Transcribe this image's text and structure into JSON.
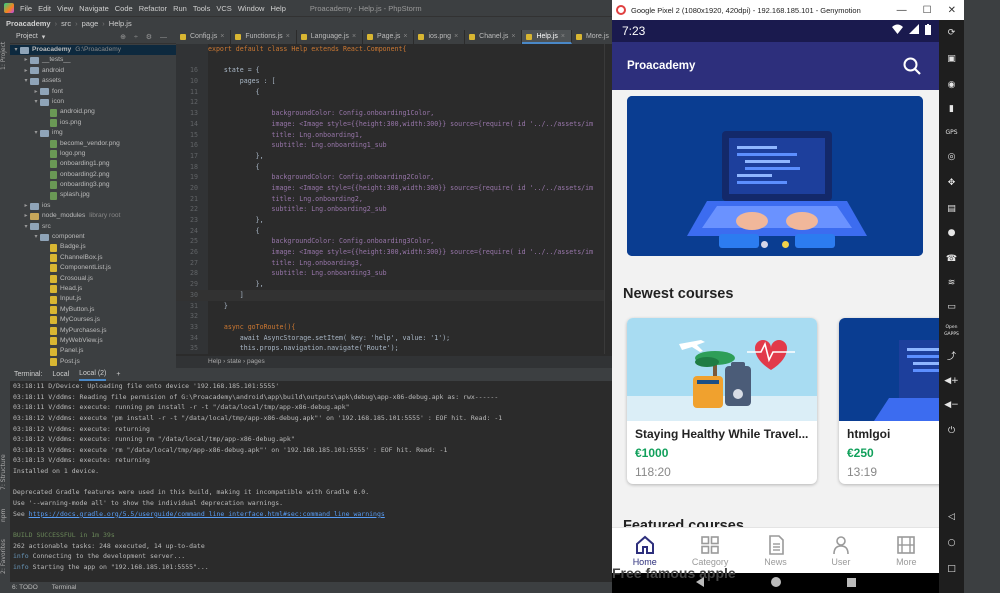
{
  "ide": {
    "menu": [
      "File",
      "Edit",
      "View",
      "Navigate",
      "Code",
      "Refactor",
      "Run",
      "Tools",
      "VCS",
      "Window",
      "Help"
    ],
    "window_title": "Proacademy - Help.js - PhpStorm",
    "breadcrumb": [
      "Proacademy",
      "src",
      "page",
      "Help.js"
    ],
    "editor_tabs": [
      {
        "label": "Config.js",
        "active": false
      },
      {
        "label": "Functions.js",
        "active": false
      },
      {
        "label": "Language.js",
        "active": false
      },
      {
        "label": "Page.js",
        "active": false
      },
      {
        "label": "ios.png",
        "active": false
      },
      {
        "label": "Chanel.js",
        "active": false
      },
      {
        "label": "Help.js",
        "active": true
      },
      {
        "label": "More.js",
        "active": false
      },
      {
        "label": "Index.",
        "active": false
      }
    ],
    "left_strip": {
      "project": "1: Project",
      "structure": "7: Structure",
      "npm": "npm",
      "favorites": "2: Favorites"
    },
    "project_panel": {
      "title": "Project",
      "icons": "⊕ ÷ ⚙ —"
    },
    "tree": [
      {
        "indent": 0,
        "arrow": "▾",
        "kind": "folder",
        "label": "Proacademy",
        "muted": "G:\\Proacademy",
        "sel": true
      },
      {
        "indent": 1,
        "arrow": "▸",
        "kind": "folder",
        "label": "__tests__"
      },
      {
        "indent": 1,
        "arrow": "▸",
        "kind": "folder",
        "label": "android"
      },
      {
        "indent": 1,
        "arrow": "▾",
        "kind": "folder",
        "label": "assets"
      },
      {
        "indent": 2,
        "arrow": "▸",
        "kind": "folder",
        "label": "font"
      },
      {
        "indent": 2,
        "arrow": "▾",
        "kind": "folder",
        "label": "icon"
      },
      {
        "indent": 3,
        "arrow": "",
        "kind": "png",
        "label": "android.png"
      },
      {
        "indent": 3,
        "arrow": "",
        "kind": "png",
        "label": "ios.png"
      },
      {
        "indent": 2,
        "arrow": "▾",
        "kind": "folder",
        "label": "img"
      },
      {
        "indent": 3,
        "arrow": "",
        "kind": "png",
        "label": "become_vendor.png"
      },
      {
        "indent": 3,
        "arrow": "",
        "kind": "png",
        "label": "logo.png"
      },
      {
        "indent": 3,
        "arrow": "",
        "kind": "png",
        "label": "onboarding1.png"
      },
      {
        "indent": 3,
        "arrow": "",
        "kind": "png",
        "label": "onboarding2.png"
      },
      {
        "indent": 3,
        "arrow": "",
        "kind": "png",
        "label": "onboarding3.png"
      },
      {
        "indent": 3,
        "arrow": "",
        "kind": "png",
        "label": "splash.jpg"
      },
      {
        "indent": 1,
        "arrow": "▸",
        "kind": "folder",
        "label": "ios"
      },
      {
        "indent": 1,
        "arrow": "▸",
        "kind": "yfolder",
        "label": "node_modules",
        "muted": "library root"
      },
      {
        "indent": 1,
        "arrow": "▾",
        "kind": "folder",
        "label": "src"
      },
      {
        "indent": 2,
        "arrow": "▾",
        "kind": "folder",
        "label": "component"
      },
      {
        "indent": 3,
        "arrow": "",
        "kind": "js",
        "label": "Badge.js"
      },
      {
        "indent": 3,
        "arrow": "",
        "kind": "js",
        "label": "ChannelBox.js"
      },
      {
        "indent": 3,
        "arrow": "",
        "kind": "js",
        "label": "ComponentList.js"
      },
      {
        "indent": 3,
        "arrow": "",
        "kind": "js",
        "label": "Crosoual.js"
      },
      {
        "indent": 3,
        "arrow": "",
        "kind": "js",
        "label": "Head.js"
      },
      {
        "indent": 3,
        "arrow": "",
        "kind": "js",
        "label": "Input.js"
      },
      {
        "indent": 3,
        "arrow": "",
        "kind": "js",
        "label": "MyButton.js"
      },
      {
        "indent": 3,
        "arrow": "",
        "kind": "js",
        "label": "MyCourses.js"
      },
      {
        "indent": 3,
        "arrow": "",
        "kind": "js",
        "label": "MyPurchases.js"
      },
      {
        "indent": 3,
        "arrow": "",
        "kind": "js",
        "label": "MyWebView.js"
      },
      {
        "indent": 3,
        "arrow": "",
        "kind": "js",
        "label": "Panel.js"
      },
      {
        "indent": 3,
        "arrow": "",
        "kind": "js",
        "label": "Post.js"
      }
    ],
    "code": [
      {
        "n": "",
        "t": "export default class Help extends React.Component{",
        "k": "class"
      },
      {
        "n": "",
        "t": "",
        "k": ""
      },
      {
        "n": "16",
        "t": "    state = {",
        "k": "plain"
      },
      {
        "n": "10",
        "t": "        pages : [",
        "k": "plain"
      },
      {
        "n": "11",
        "t": "            {",
        "k": "plain"
      },
      {
        "n": "12",
        "t": "",
        "k": ""
      },
      {
        "n": "13",
        "t": "                backgroundColor: Config.onboarding1Color,",
        "k": "prop"
      },
      {
        "n": "14",
        "t": "                image: <Image style={{height:300,width:300}} source={require( id '../../assets/im",
        "k": "img"
      },
      {
        "n": "15",
        "t": "                title: Lng.onboarding1,",
        "k": "prop"
      },
      {
        "n": "16",
        "t": "                subtitle: Lng.onboarding1_sub",
        "k": "prop"
      },
      {
        "n": "17",
        "t": "            },",
        "k": "plain"
      },
      {
        "n": "18",
        "t": "            {",
        "k": "plain"
      },
      {
        "n": "19",
        "t": "                backgroundColor: Config.onboarding2Color,",
        "k": "prop"
      },
      {
        "n": "20",
        "t": "                image: <Image style={{height:300,width:300}} source={require( id '../../assets/im",
        "k": "img"
      },
      {
        "n": "21",
        "t": "                title: Lng.onboarding2,",
        "k": "prop"
      },
      {
        "n": "22",
        "t": "                subtitle: Lng.onboarding2_sub",
        "k": "prop"
      },
      {
        "n": "23",
        "t": "            },",
        "k": "plain"
      },
      {
        "n": "24",
        "t": "            {",
        "k": "plain"
      },
      {
        "n": "25",
        "t": "                backgroundColor: Config.onboarding3Color,",
        "k": "prop"
      },
      {
        "n": "26",
        "t": "                image: <Image style={{height:300,width:300}} source={require( id '../../assets/im",
        "k": "img"
      },
      {
        "n": "27",
        "t": "                title: Lng.onboarding3,",
        "k": "prop"
      },
      {
        "n": "28",
        "t": "                subtitle: Lng.onboarding3_sub",
        "k": "prop"
      },
      {
        "n": "29",
        "t": "            },",
        "k": "plain"
      },
      {
        "n": "30",
        "t": "        ]",
        "k": "cur"
      },
      {
        "n": "31",
        "t": "    }",
        "k": "plain"
      },
      {
        "n": "32",
        "t": "",
        "k": ""
      },
      {
        "n": "33",
        "t": "    async goToRoute(){",
        "k": "async"
      },
      {
        "n": "34",
        "t": "        await AsyncStorage.setItem( key: 'help', value: '1');",
        "k": "await"
      },
      {
        "n": "35",
        "t": "        this.props.navigation.navigate('Route');",
        "k": "nav"
      }
    ],
    "code_breadcrumb": "Help   ›   state   ›   pages",
    "terminal_tabs": [
      "Terminal:",
      "Local",
      "Local (2)",
      "+"
    ],
    "terminal_lines": [
      {
        "t": "03:18:11 D/Device: Uploading file onto device '192.168.185.101:5555'",
        "k": "plain"
      },
      {
        "t": "03:18:11 V/ddms: Reading file permision of G:\\Proacademy\\android\\app\\build\\outputs\\apk\\debug\\app-x86-debug.apk as: rwx------",
        "k": "plain"
      },
      {
        "t": "03:18:11 V/ddms: execute: running pm install -r -t \"/data/local/tmp/app-x86-debug.apk\"",
        "k": "plain"
      },
      {
        "t": "03:18:12 V/ddms: execute 'pm install -r -t \"/data/local/tmp/app-x86-debug.apk\"' on '192.168.185.101:5555' : EOF hit. Read: -1",
        "k": "plain"
      },
      {
        "t": "03:18:12 V/ddms: execute: returning",
        "k": "plain"
      },
      {
        "t": "03:18:12 V/ddms: execute: running rm \"/data/local/tmp/app-x86-debug.apk\"",
        "k": "plain"
      },
      {
        "t": "03:18:13 V/ddms: execute 'rm \"/data/local/tmp/app-x86-debug.apk\"' on '192.168.185.101:5555' : EOF hit. Read: -1",
        "k": "plain"
      },
      {
        "t": "03:18:13 V/ddms: execute: returning",
        "k": "plain"
      },
      {
        "t": "Installed on 1 device.",
        "k": "plain"
      },
      {
        "t": "",
        "k": "plain"
      },
      {
        "t": "Deprecated Gradle features were used in this build, making it incompatible with Gradle 6.0.",
        "k": "plain"
      },
      {
        "t": "Use '--warning-mode all' to show the individual deprecation warnings.",
        "k": "plain"
      },
      {
        "t": "See ",
        "k": "link",
        "href": "https://docs.gradle.org/5.5/userguide/command_line_interface.html#sec:command_line_warnings"
      },
      {
        "t": "",
        "k": "plain"
      },
      {
        "t": "BUILD SUCCESSFUL in 1m 39s",
        "k": "green"
      },
      {
        "t": "262 actionable tasks: 248 executed, 14 up-to-date",
        "k": "plain"
      },
      {
        "t": "info",
        "k": "info",
        "rest": " Connecting to the development server..."
      },
      {
        "t": "info",
        "k": "info",
        "rest": " Starting the app on \"192.168.185.101:5555\"..."
      }
    ],
    "status_items": [
      "6: TODO",
      "Terminal"
    ]
  },
  "emulator": {
    "window_title": "Google Pixel 2 (1080x1920, 420dpi) - 192.168.185.101 - Genymotion",
    "window_controls": [
      "—",
      "☐",
      "✕"
    ],
    "status_time": "7:23",
    "app_title": "Proacademy",
    "section_newest": "Newest courses",
    "section_featured": "Featured courses",
    "overlay_text": "Free famous apple",
    "courses": [
      {
        "title": "Staying Healthy While Travel...",
        "price": "€1000",
        "duration": "118:20"
      },
      {
        "title": "htmlgoi",
        "price": "€250",
        "duration": "13:19"
      }
    ],
    "nav": [
      {
        "label": "Home",
        "icon": "home-icon",
        "active": true
      },
      {
        "label": "Category",
        "icon": "category-icon",
        "active": false
      },
      {
        "label": "News",
        "icon": "news-icon",
        "active": false
      },
      {
        "label": "User",
        "icon": "user-icon",
        "active": false
      },
      {
        "label": "More",
        "icon": "more-icon",
        "active": false
      }
    ],
    "side_buttons": [
      "battery-icon",
      "gps-icon",
      "camera-icon",
      "move-icon",
      "id-icon",
      "disk-icon",
      "phone-icon",
      "sms-icon",
      "open-gapps-icon",
      "share-icon",
      "volume-up-icon",
      "volume-down-icon",
      "power-icon",
      "back-key-icon",
      "home-key-icon",
      "recents-key-icon"
    ],
    "open_gapps_label": "Open GAPPS",
    "gps_label": "GPS",
    "accent": "#2d2f7c",
    "price_color": "#11a05b"
  }
}
